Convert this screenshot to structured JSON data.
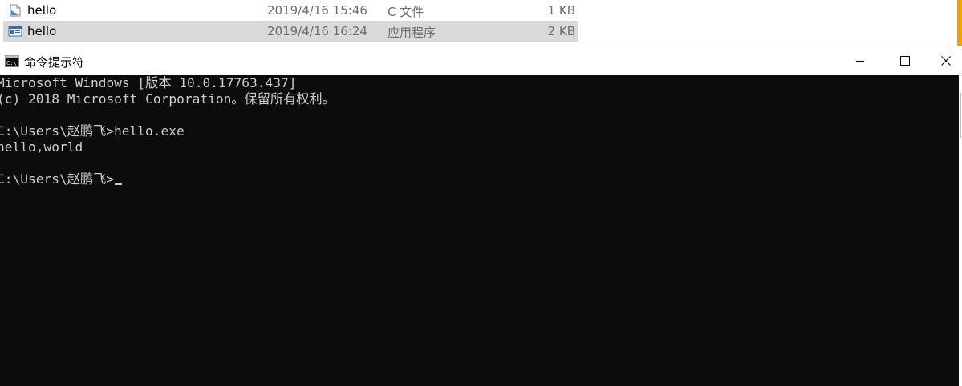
{
  "explorer": {
    "files": [
      {
        "name": "hello",
        "date": "2019/4/16 15:46",
        "type": "C 文件",
        "size": "1 KB",
        "icon": "c-source-file-icon"
      },
      {
        "name": "hello",
        "date": "2019/4/16 16:24",
        "type": "应用程序",
        "size": "2 KB",
        "icon": "application-exe-icon",
        "selected": true
      }
    ]
  },
  "console": {
    "title": "命令提示符",
    "icon": "cmd-icon",
    "lines": [
      "Microsoft Windows [版本 10.0.17763.437]",
      "(c) 2018 Microsoft Corporation。保留所有权利。",
      "",
      "C:\\Users\\赵鹏飞>hello.exe",
      "hello,world",
      "",
      "C:\\Users\\赵鹏飞>"
    ],
    "controls": {
      "minimize": "minimize-icon",
      "maximize": "maximize-icon",
      "close": "close-icon"
    }
  },
  "colors": {
    "terminal_bg": "#0c0c0c",
    "terminal_fg": "#cccccc",
    "selection_bg": "#d9d9d9",
    "accent_orange": "#f0a000"
  }
}
